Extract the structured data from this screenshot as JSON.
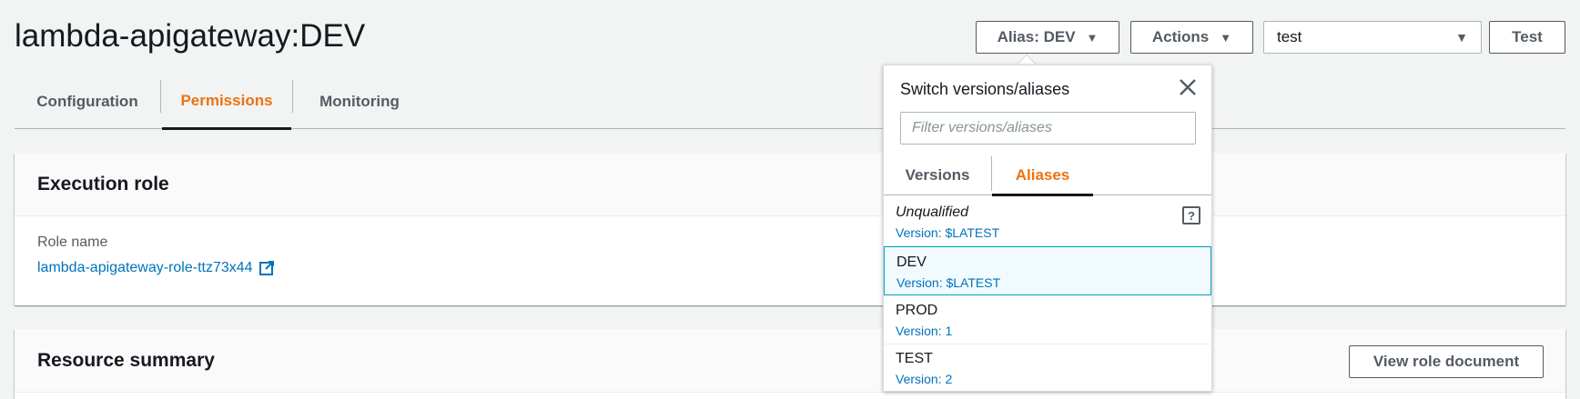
{
  "header": {
    "title": "lambda-apigateway:DEV",
    "alias_button": "Alias: DEV",
    "actions_button": "Actions",
    "test_event_select": "test",
    "test_button": "Test"
  },
  "tabs": [
    {
      "label": "Configuration",
      "active": false
    },
    {
      "label": "Permissions",
      "active": true
    },
    {
      "label": "Monitoring",
      "active": false
    }
  ],
  "execution_role": {
    "heading": "Execution role",
    "role_name_label": "Role name",
    "role_name_link": "lambda-apigateway-role-ttz73x44"
  },
  "resource_summary": {
    "heading": "Resource summary",
    "view_button": "View role document"
  },
  "popover": {
    "title": "Switch versions/aliases",
    "filter_placeholder": "Filter versions/aliases",
    "tabs": [
      {
        "label": "Versions",
        "active": false
      },
      {
        "label": "Aliases",
        "active": true
      }
    ],
    "items": [
      {
        "name": "Unqualified",
        "version": "Version: $LATEST",
        "selected": false
      },
      {
        "name": "DEV",
        "version": "Version: $LATEST",
        "selected": true
      },
      {
        "name": "PROD",
        "version": "Version: 1",
        "selected": false
      },
      {
        "name": "TEST",
        "version": "Version: 2",
        "selected": false
      }
    ]
  },
  "colors": {
    "accent": "#ec7211",
    "link": "#0073bb",
    "selected_border": "#00a1c9",
    "selected_bg": "#f1faff"
  }
}
